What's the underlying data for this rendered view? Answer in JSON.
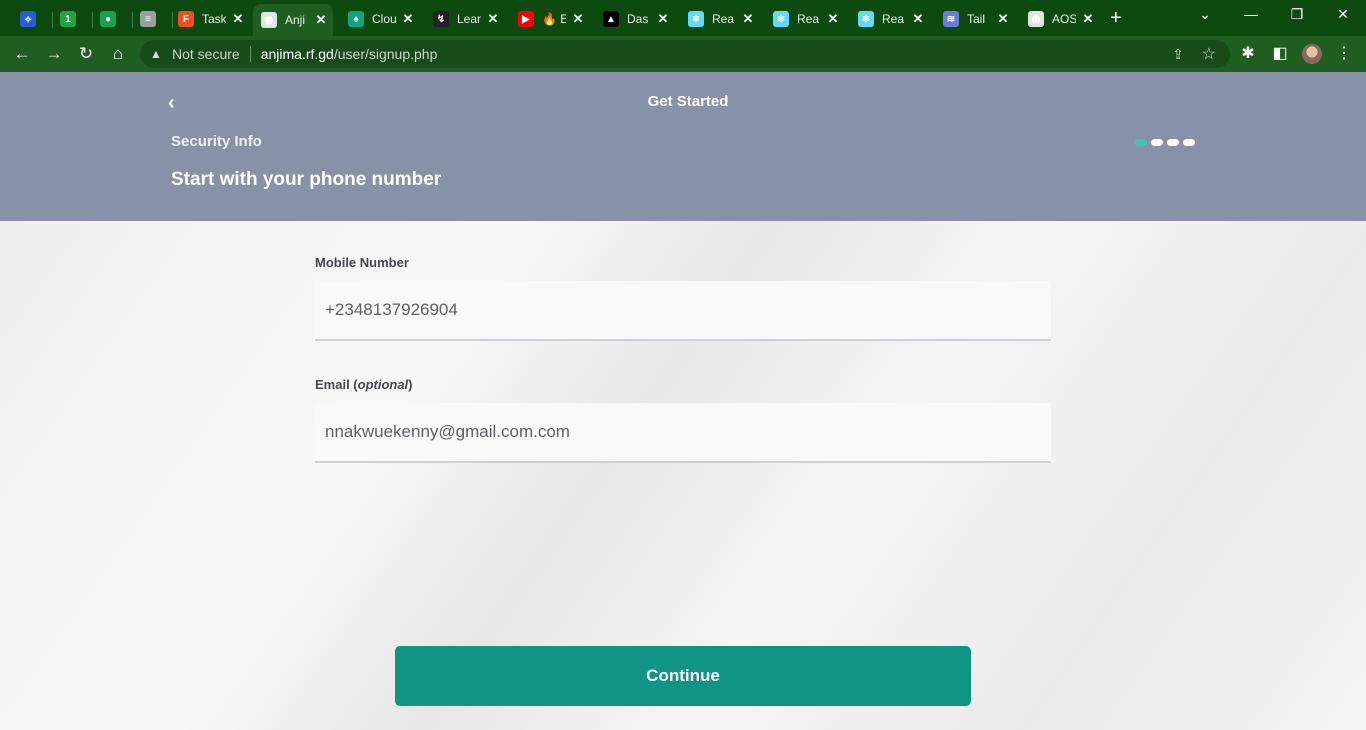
{
  "browser": {
    "tabs": [
      {
        "icon": "jira-icon",
        "title": "",
        "color": "#2a5bd7",
        "glyph": "⟡"
      },
      {
        "icon": "whatsapp-icon",
        "title": "",
        "color": "#25a244",
        "glyph": "1"
      },
      {
        "icon": "circle-app-icon",
        "title": "",
        "color": "#16a34a",
        "glyph": "●"
      },
      {
        "icon": "list-icon",
        "title": "",
        "color": "#9aa09a",
        "glyph": "≡"
      },
      {
        "icon": "figma-icon",
        "title": "Task",
        "color": "#f24e1e",
        "glyph": "F"
      },
      {
        "icon": "globe-icon",
        "title": "Anji",
        "color": "#dfe8df",
        "glyph": "◍"
      },
      {
        "icon": "leaf-icon",
        "title": "Clou",
        "color": "#10a37f",
        "glyph": "♠"
      },
      {
        "icon": "learn-icon",
        "title": "Lear",
        "color": "#222222",
        "glyph": "↯"
      },
      {
        "icon": "youtube-icon",
        "title": "🔥 E",
        "color": "#ff0000",
        "glyph": "▶"
      },
      {
        "icon": "vercel-icon",
        "title": "Das",
        "color": "#000000",
        "glyph": "▲"
      },
      {
        "icon": "react-icon",
        "title": "Rea",
        "color": "#61dafb",
        "glyph": "⚛"
      },
      {
        "icon": "react-icon",
        "title": "Rea",
        "color": "#61dafb",
        "glyph": "⚛"
      },
      {
        "icon": "react-icon",
        "title": "Rea",
        "color": "#61dafb",
        "glyph": "⚛"
      },
      {
        "icon": "tailwind-icon",
        "title": "Tail",
        "color": "#6b7bdb",
        "glyph": "≋"
      },
      {
        "icon": "globe-icon",
        "title": "AOS",
        "color": "#dfe8df",
        "glyph": "◍"
      }
    ],
    "new_tab": "+",
    "not_secure": "Not secure",
    "url_host": "anjima.rf.gd",
    "url_path": "/user/signup.php"
  },
  "header": {
    "back": "‹",
    "title": "Get Started",
    "step_label": "Security Info",
    "headline": "Start with your phone number",
    "steps_total": 4,
    "step_current": 1
  },
  "form": {
    "mobile_label": "Mobile Number",
    "mobile_value": "+2348137926904",
    "email_label": "Email (",
    "email_label_optional": "optional",
    "email_label_end": ")",
    "email_value": "nnakwuekenny@gmail.com.com",
    "continue_label": "Continue"
  },
  "colors": {
    "accent": "#0f9486",
    "header_bg": "#8792a8",
    "step_active": "#3cc9b3"
  }
}
